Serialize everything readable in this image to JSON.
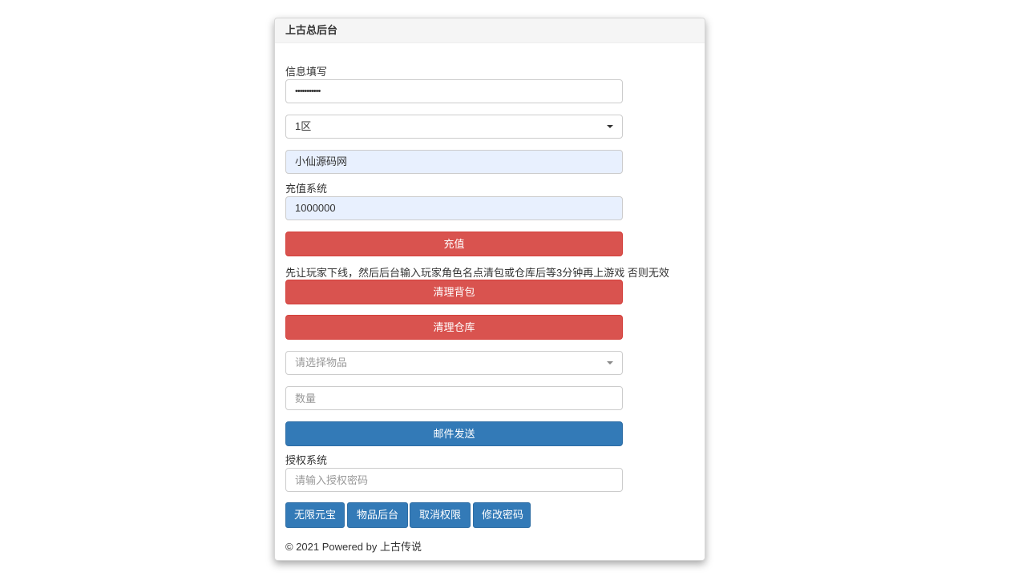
{
  "panel": {
    "title": "上古总后台"
  },
  "info": {
    "section_label": "信息填写",
    "password_value": "•••••••••••",
    "server_select_value": "1区",
    "role_name_value": "小仙源码网"
  },
  "recharge": {
    "section_label": "充值系统",
    "amount_value": "1000000",
    "submit_label": "充值"
  },
  "cleanup": {
    "notice": "先让玩家下线，然后后台输入玩家角色名点清包或仓库后等3分钟再上游戏 否则无效",
    "clear_bag_label": "清理背包",
    "clear_warehouse_label": "清理仓库"
  },
  "mail": {
    "item_select_placeholder": "请选择物品",
    "quantity_placeholder": "数量",
    "send_label": "邮件发送"
  },
  "auth": {
    "section_label": "授权系统",
    "password_placeholder": "请输入授权密码",
    "buttons": [
      "无限元宝",
      "物品后台",
      "取消权限",
      "修改密码"
    ]
  },
  "footer": {
    "text": "© 2021 Powered by 上古传说"
  },
  "colors": {
    "danger": "#d9534f",
    "primary": "#337ab7",
    "autofill": "#e8f0fe"
  }
}
